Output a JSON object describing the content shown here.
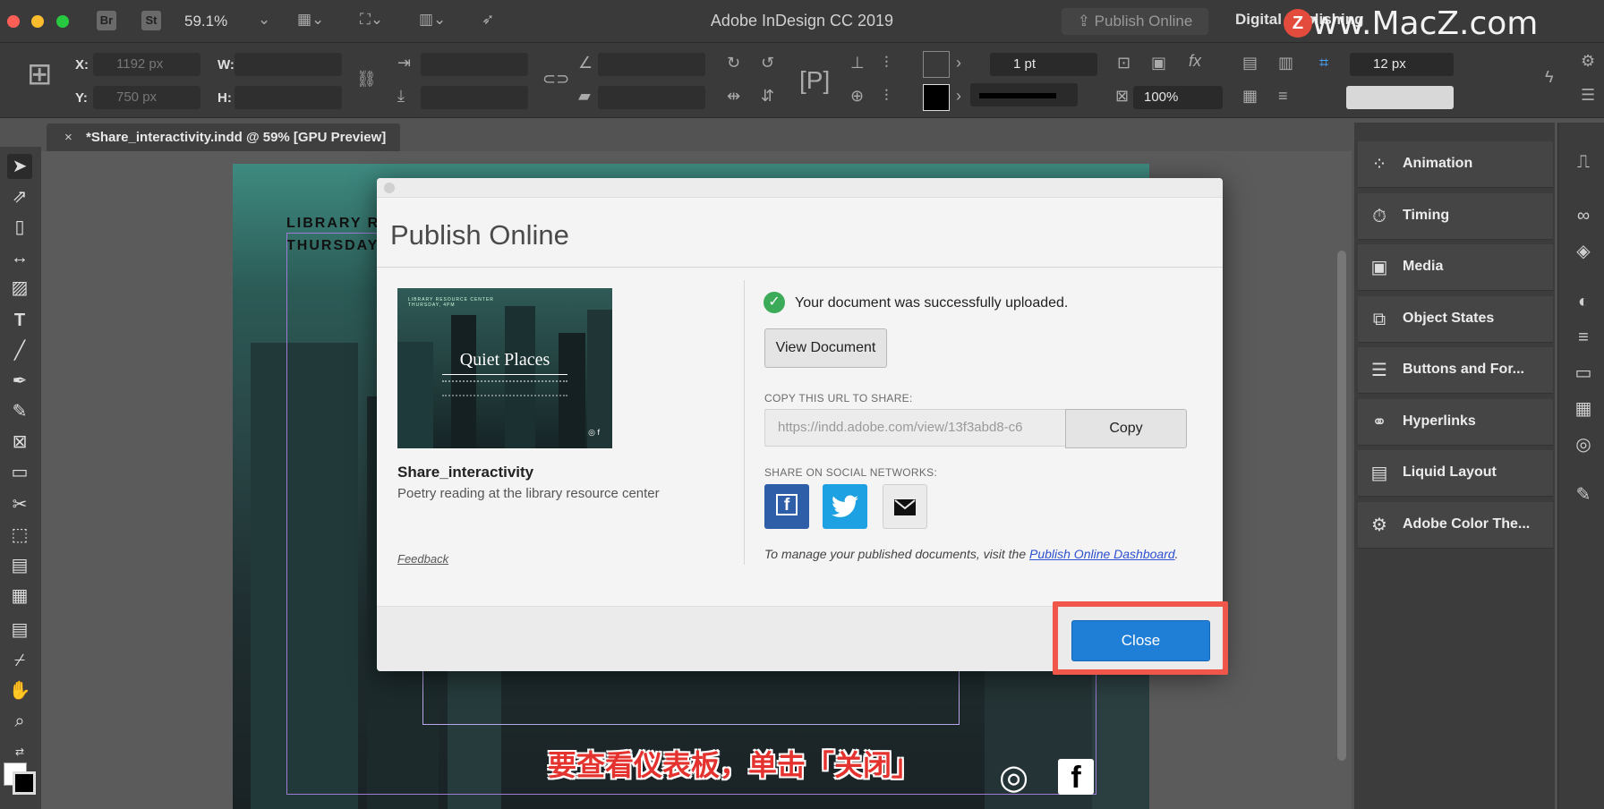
{
  "app": {
    "title": "Adobe InDesign CC 2019",
    "zoom": "59.1%",
    "br_label": "Br",
    "st_label": "St",
    "publish_online_label": "Publish Online",
    "workspace_label": "Digital Publishing",
    "watermark": "www.MacZ.com",
    "watermark_badge": "Z"
  },
  "control_bar": {
    "x_label": "X:",
    "x_value": "1192 px",
    "y_label": "Y:",
    "y_value": "750 px",
    "w_label": "W:",
    "h_label": "H:",
    "stroke_weight": "1 pt",
    "opacity": "100%",
    "gap": "12 px",
    "fill_color": "#ffffff",
    "stroke_color": "#000000"
  },
  "document_tab": {
    "close": "×",
    "title": "*Share_interactivity.indd @ 59% [GPU Preview]"
  },
  "page": {
    "line1": "LIBRARY R",
    "line2": "THURSDAY"
  },
  "subtitle": "要查看仪表板，单击「关闭」",
  "panels": [
    {
      "name": "Animation",
      "icon": "animation-icon"
    },
    {
      "name": "Timing",
      "icon": "timing-icon"
    },
    {
      "name": "Media",
      "icon": "media-icon"
    },
    {
      "name": "Object States",
      "icon": "object-states-icon"
    },
    {
      "name": "Buttons and For...",
      "icon": "buttons-forms-icon"
    },
    {
      "name": "Hyperlinks",
      "icon": "hyperlinks-icon"
    },
    {
      "name": "Liquid Layout",
      "icon": "liquid-layout-icon"
    },
    {
      "name": "Adobe Color The...",
      "icon": "adobe-color-icon"
    }
  ],
  "dialog": {
    "title": "Publish Online",
    "thumbnail": {
      "small_text": "LIBRARY RESOURCE CENTER\nTHURSDAY, 4PM",
      "title": "Quiet Places"
    },
    "document_name": "Share_interactivity",
    "document_description": "Poetry reading at the library resource center",
    "feedback": "Feedback",
    "success_message": "Your document was successfully uploaded.",
    "view_document": "View Document",
    "copy_url_label": "COPY THIS URL TO SHARE:",
    "url": "https://indd.adobe.com/view/13f3abd8-c6",
    "copy_button": "Copy",
    "share_label": "SHARE ON SOCIAL NETWORKS:",
    "manage_text": "To manage your published documents, visit the ",
    "manage_link": "Publish Online Dashboard",
    "manage_end": ".",
    "close_button": "Close"
  }
}
